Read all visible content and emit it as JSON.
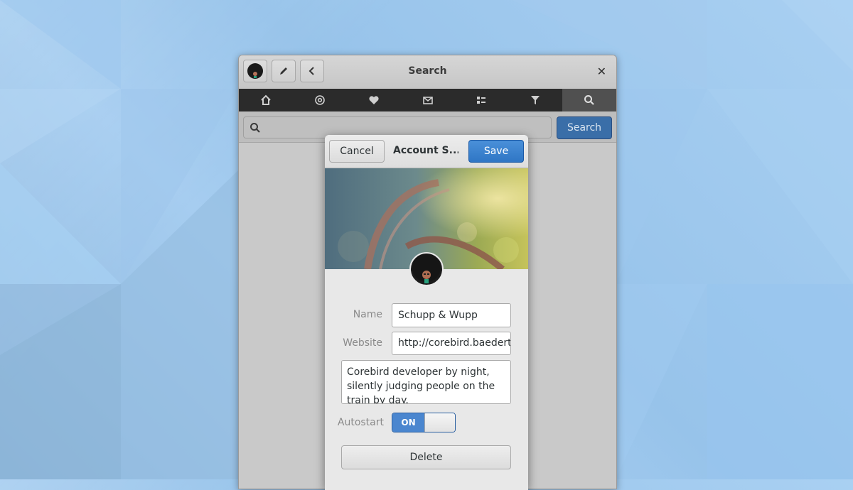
{
  "window": {
    "title": "Search",
    "close_glyph": "✕",
    "header_buttons": [
      "avatar",
      "compose-icon",
      "back-icon"
    ],
    "tabs": [
      "home-icon",
      "mentions-icon",
      "favorites-icon",
      "messages-icon",
      "lists-icon",
      "filters-icon",
      "search-icon"
    ],
    "active_tab": "search-icon"
  },
  "search": {
    "placeholder": "",
    "button_label": "Search"
  },
  "dialog": {
    "cancel_label": "Cancel",
    "title": "Account S...",
    "save_label": "Save",
    "name_label": "Name",
    "name_value": "Schupp & Wupp",
    "website_label": "Website",
    "website_value": "http://corebird.baedert.",
    "description": "Corebird developer by night, silently judging people on the train by day.",
    "autostart_label": "Autostart",
    "autostart_state": "ON",
    "delete_label": "Delete"
  },
  "colors": {
    "accent": "#3a7ccc",
    "tabbar": "#2b2b2b",
    "desktop": "#a6cdf0"
  }
}
